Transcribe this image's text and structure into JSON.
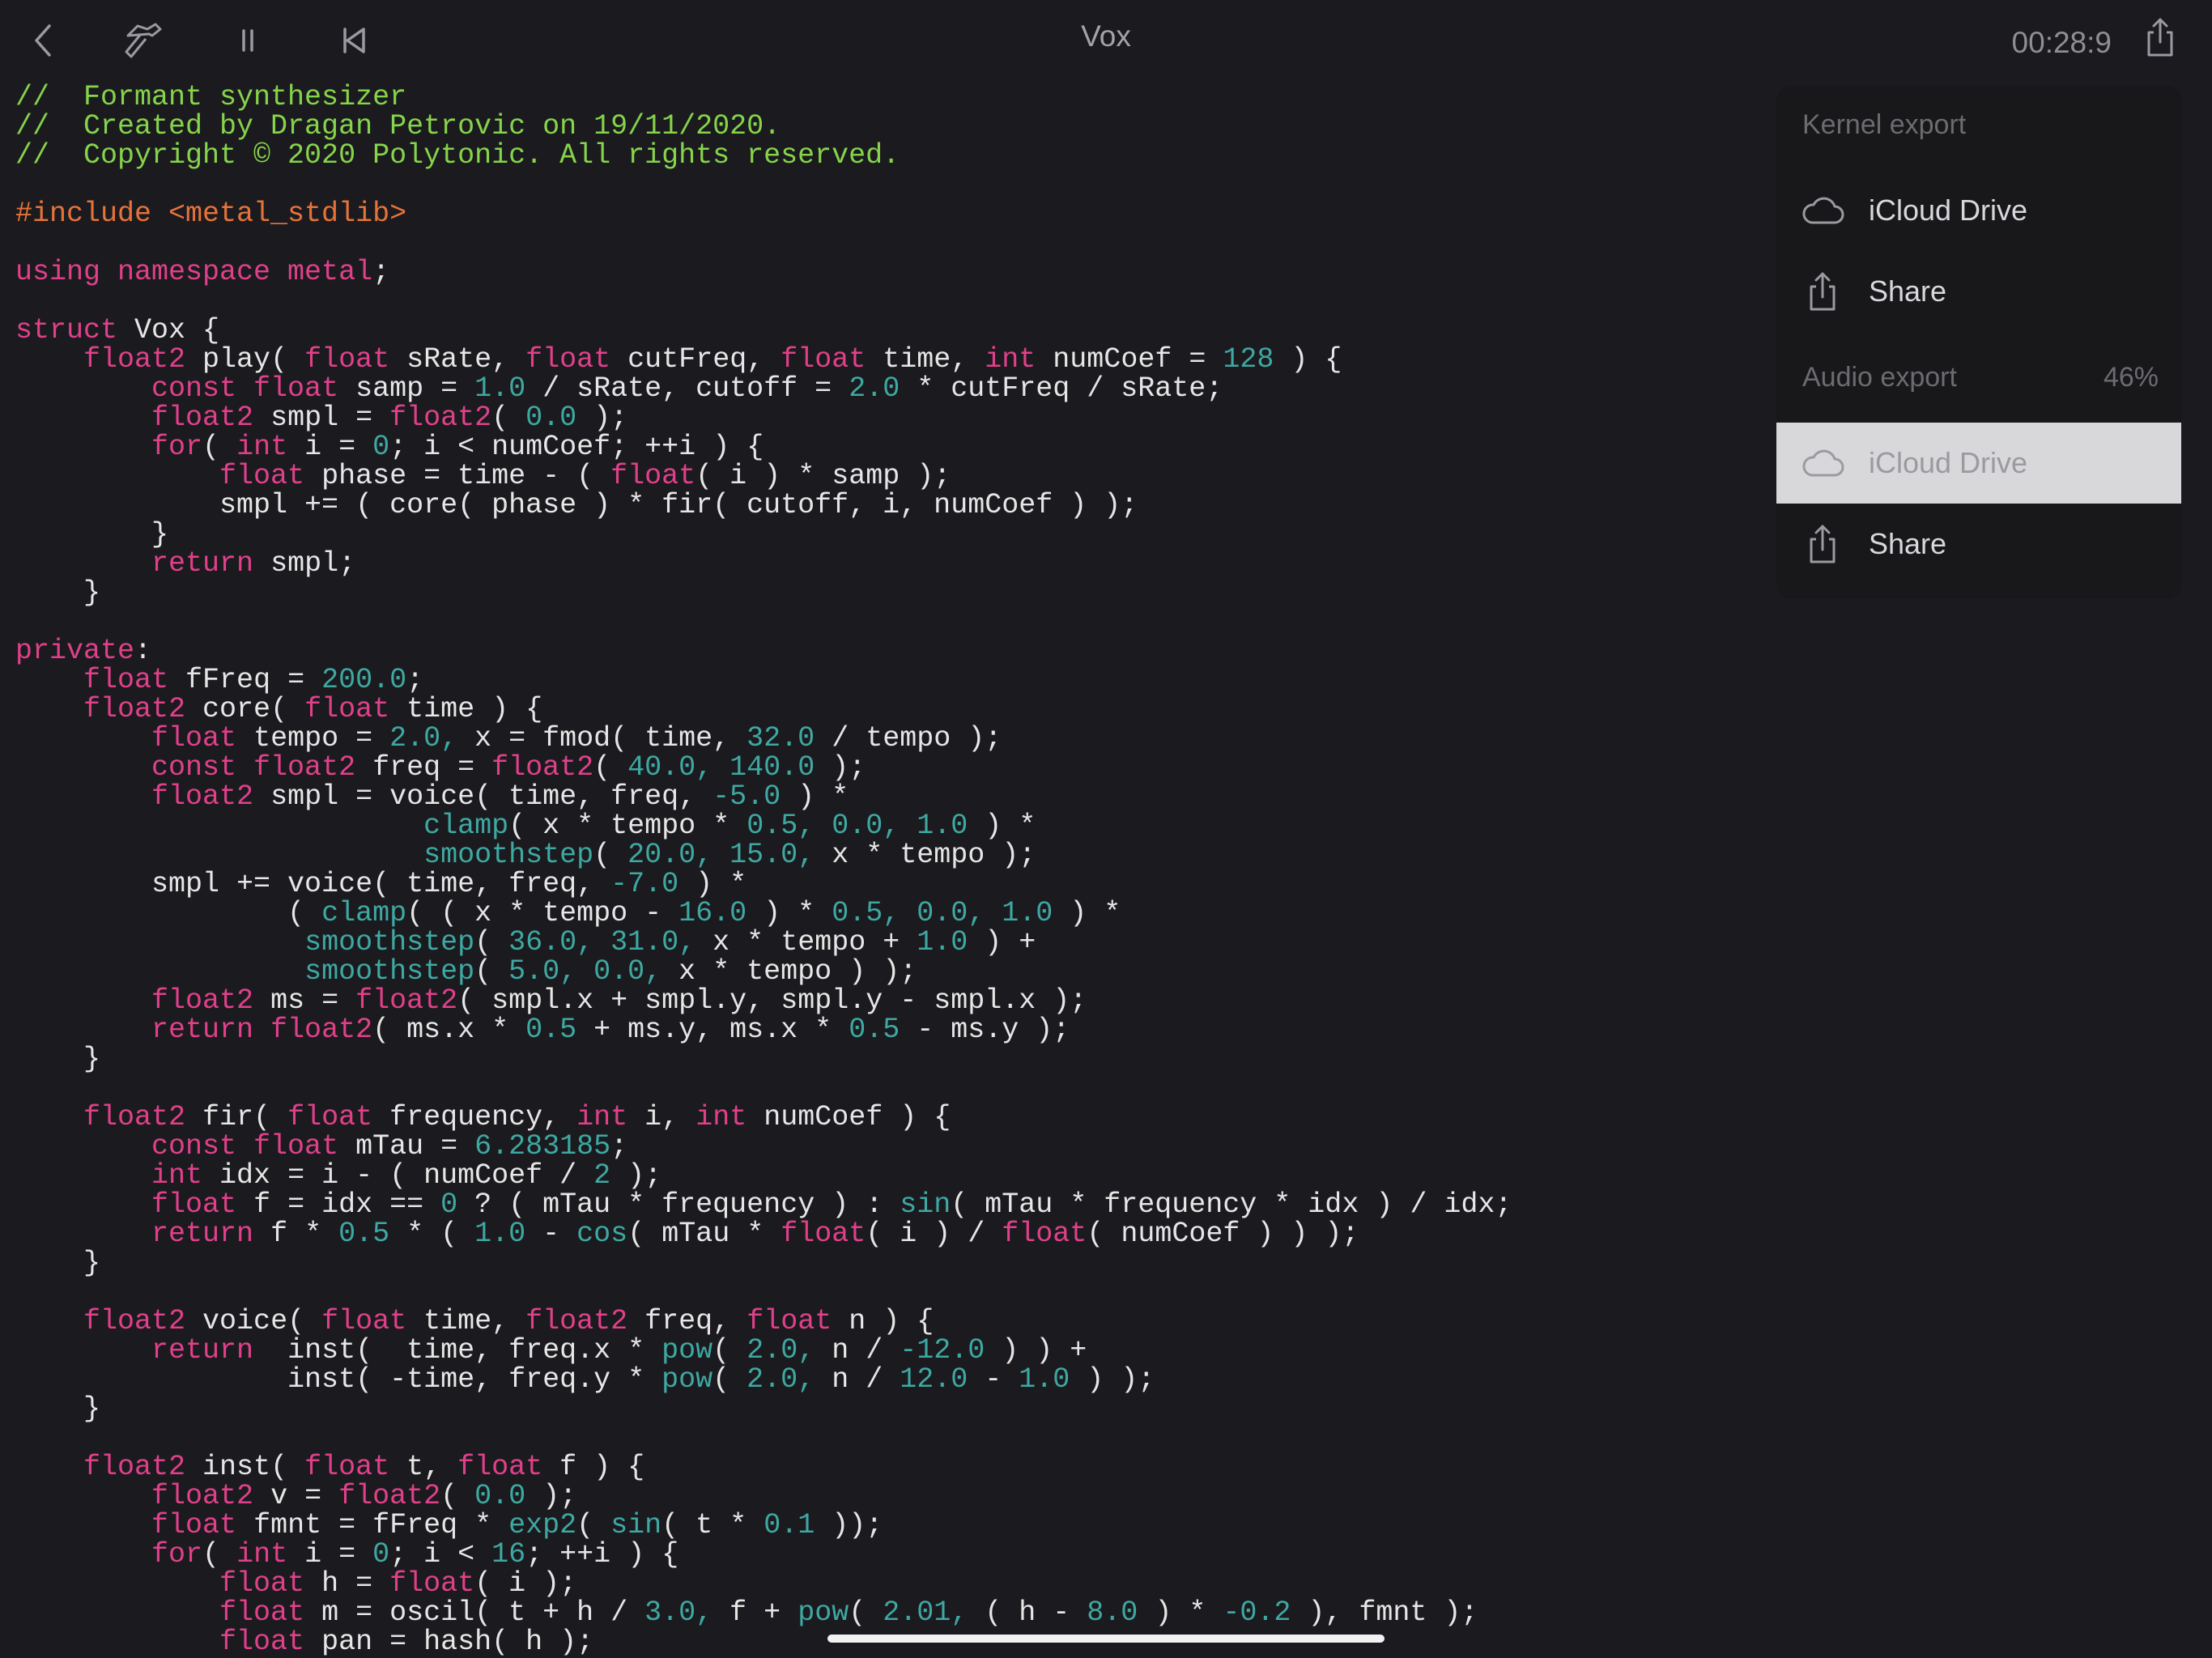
{
  "app": {
    "title": "Vox",
    "timer": "00:28:9"
  },
  "toolbar": {
    "icons": [
      "back-icon",
      "build-icon",
      "pause-icon",
      "rewind-icon",
      "share-icon"
    ]
  },
  "colors": {
    "default": "#e6e6e6",
    "comment": "#86d44a",
    "keyword": "#e0408a",
    "number": "#3ea8a2",
    "include": "#e6733a"
  },
  "code_lines": [
    [
      [
        "c",
        "//  Formant synthesizer"
      ]
    ],
    [
      [
        "c",
        "//  Created by Dragan Petrovic on 19/11/2020."
      ]
    ],
    [
      [
        "c",
        "//  Copyright © 2020 Polytonic. All rights reserved."
      ]
    ],
    [],
    [
      [
        "i",
        "#include <metal_stdlib>"
      ]
    ],
    [],
    [
      [
        "k",
        "using namespace metal"
      ],
      [
        "d",
        ";"
      ]
    ],
    [],
    [
      [
        "k",
        "struct"
      ],
      [
        "d",
        " Vox {"
      ]
    ],
    [
      [
        "d",
        "    "
      ],
      [
        "k",
        "float2"
      ],
      [
        "d",
        " play( "
      ],
      [
        "k",
        "float"
      ],
      [
        "d",
        " sRate, "
      ],
      [
        "k",
        "float"
      ],
      [
        "d",
        " cutFreq, "
      ],
      [
        "k",
        "float"
      ],
      [
        "d",
        " time, "
      ],
      [
        "k",
        "int"
      ],
      [
        "d",
        " numCoef = "
      ],
      [
        "n",
        "128"
      ],
      [
        "d",
        " ) {"
      ]
    ],
    [
      [
        "d",
        "        "
      ],
      [
        "k",
        "const float"
      ],
      [
        "d",
        " samp = "
      ],
      [
        "n",
        "1.0"
      ],
      [
        "d",
        " / sRate, cutoff = "
      ],
      [
        "n",
        "2.0"
      ],
      [
        "d",
        " * cutFreq / sRate;"
      ]
    ],
    [
      [
        "d",
        "        "
      ],
      [
        "k",
        "float2"
      ],
      [
        "d",
        " smpl = "
      ],
      [
        "k",
        "float2"
      ],
      [
        "d",
        "( "
      ],
      [
        "n",
        "0.0"
      ],
      [
        "d",
        " );"
      ]
    ],
    [
      [
        "d",
        "        "
      ],
      [
        "k",
        "for"
      ],
      [
        "d",
        "( "
      ],
      [
        "k",
        "int"
      ],
      [
        "d",
        " i = "
      ],
      [
        "n",
        "0"
      ],
      [
        "d",
        "; i < numCoef; ++i ) {"
      ]
    ],
    [
      [
        "d",
        "            "
      ],
      [
        "k",
        "float"
      ],
      [
        "d",
        " phase = time - ( "
      ],
      [
        "k",
        "float"
      ],
      [
        "d",
        "( i ) * samp );"
      ]
    ],
    [
      [
        "d",
        "            smpl += ( core( phase ) * fir( cutoff, i, numCoef ) );"
      ]
    ],
    [
      [
        "d",
        "        }"
      ]
    ],
    [
      [
        "d",
        "        "
      ],
      [
        "k",
        "return"
      ],
      [
        "d",
        " smpl;"
      ]
    ],
    [
      [
        "d",
        "    }"
      ]
    ],
    [],
    [
      [
        "k",
        "private"
      ],
      [
        "d",
        ":"
      ]
    ],
    [
      [
        "d",
        "    "
      ],
      [
        "k",
        "float"
      ],
      [
        "d",
        " fFreq = "
      ],
      [
        "n",
        "200.0"
      ],
      [
        "d",
        ";"
      ]
    ],
    [
      [
        "d",
        "    "
      ],
      [
        "k",
        "float2"
      ],
      [
        "d",
        " core( "
      ],
      [
        "k",
        "float"
      ],
      [
        "d",
        " time ) {"
      ]
    ],
    [
      [
        "d",
        "        "
      ],
      [
        "k",
        "float"
      ],
      [
        "d",
        " tempo = "
      ],
      [
        "n",
        "2.0,"
      ],
      [
        "d",
        " x = fmod( time, "
      ],
      [
        "n",
        "32.0"
      ],
      [
        "d",
        " / tempo );"
      ]
    ],
    [
      [
        "d",
        "        "
      ],
      [
        "k",
        "const float2"
      ],
      [
        "d",
        " freq = "
      ],
      [
        "k",
        "float2"
      ],
      [
        "d",
        "( "
      ],
      [
        "n",
        "40.0, 140.0"
      ],
      [
        "d",
        " );"
      ]
    ],
    [
      [
        "d",
        "        "
      ],
      [
        "k",
        "float2"
      ],
      [
        "d",
        " smpl = voice( time, freq, "
      ],
      [
        "n",
        "-5.0"
      ],
      [
        "d",
        " ) *"
      ]
    ],
    [
      [
        "d",
        "                        "
      ],
      [
        "n",
        "clamp"
      ],
      [
        "d",
        "( x * tempo * "
      ],
      [
        "n",
        "0.5, 0.0, 1.0"
      ],
      [
        "d",
        " ) *"
      ]
    ],
    [
      [
        "d",
        "                        "
      ],
      [
        "n",
        "smoothstep"
      ],
      [
        "d",
        "( "
      ],
      [
        "n",
        "20.0, 15.0,"
      ],
      [
        "d",
        " x * tempo );"
      ]
    ],
    [
      [
        "d",
        "        smpl += voice( time, freq, "
      ],
      [
        "n",
        "-7.0"
      ],
      [
        "d",
        " ) *"
      ]
    ],
    [
      [
        "d",
        "                ( "
      ],
      [
        "n",
        "clamp"
      ],
      [
        "d",
        "( ( x * tempo - "
      ],
      [
        "n",
        "16.0"
      ],
      [
        "d",
        " ) * "
      ],
      [
        "n",
        "0.5, 0.0, 1.0"
      ],
      [
        "d",
        " ) *"
      ]
    ],
    [
      [
        "d",
        "                 "
      ],
      [
        "n",
        "smoothstep"
      ],
      [
        "d",
        "( "
      ],
      [
        "n",
        "36.0, 31.0,"
      ],
      [
        "d",
        " x * tempo + "
      ],
      [
        "n",
        "1.0"
      ],
      [
        "d",
        " ) +"
      ]
    ],
    [
      [
        "d",
        "                 "
      ],
      [
        "n",
        "smoothstep"
      ],
      [
        "d",
        "( "
      ],
      [
        "n",
        "5.0, 0.0,"
      ],
      [
        "d",
        " x * tempo ) );"
      ]
    ],
    [
      [
        "d",
        "        "
      ],
      [
        "k",
        "float2"
      ],
      [
        "d",
        " ms = "
      ],
      [
        "k",
        "float2"
      ],
      [
        "d",
        "( smpl.x + smpl.y, smpl.y - smpl.x );"
      ]
    ],
    [
      [
        "d",
        "        "
      ],
      [
        "k",
        "return float2"
      ],
      [
        "d",
        "( ms.x * "
      ],
      [
        "n",
        "0.5"
      ],
      [
        "d",
        " + ms.y, ms.x * "
      ],
      [
        "n",
        "0.5"
      ],
      [
        "d",
        " - ms.y );"
      ]
    ],
    [
      [
        "d",
        "    }"
      ]
    ],
    [],
    [
      [
        "d",
        "    "
      ],
      [
        "k",
        "float2"
      ],
      [
        "d",
        " fir( "
      ],
      [
        "k",
        "float"
      ],
      [
        "d",
        " frequency, "
      ],
      [
        "k",
        "int"
      ],
      [
        "d",
        " i, "
      ],
      [
        "k",
        "int"
      ],
      [
        "d",
        " numCoef ) {"
      ]
    ],
    [
      [
        "d",
        "        "
      ],
      [
        "k",
        "const float"
      ],
      [
        "d",
        " mTau = "
      ],
      [
        "n",
        "6.283185"
      ],
      [
        "d",
        ";"
      ]
    ],
    [
      [
        "d",
        "        "
      ],
      [
        "k",
        "int"
      ],
      [
        "d",
        " idx = i - ( numCoef / "
      ],
      [
        "n",
        "2"
      ],
      [
        "d",
        " );"
      ]
    ],
    [
      [
        "d",
        "        "
      ],
      [
        "k",
        "float"
      ],
      [
        "d",
        " f = idx == "
      ],
      [
        "n",
        "0"
      ],
      [
        "d",
        " ? ( mTau * frequency ) : "
      ],
      [
        "n",
        "sin"
      ],
      [
        "d",
        "( mTau * frequency * idx ) / idx;"
      ]
    ],
    [
      [
        "d",
        "        "
      ],
      [
        "k",
        "return"
      ],
      [
        "d",
        " f * "
      ],
      [
        "n",
        "0.5"
      ],
      [
        "d",
        " * ( "
      ],
      [
        "n",
        "1.0"
      ],
      [
        "d",
        " - "
      ],
      [
        "n",
        "cos"
      ],
      [
        "d",
        "( mTau * "
      ],
      [
        "k",
        "float"
      ],
      [
        "d",
        "( i ) / "
      ],
      [
        "k",
        "float"
      ],
      [
        "d",
        "( numCoef ) ) );"
      ]
    ],
    [
      [
        "d",
        "    }"
      ]
    ],
    [],
    [
      [
        "d",
        "    "
      ],
      [
        "k",
        "float2"
      ],
      [
        "d",
        " voice( "
      ],
      [
        "k",
        "float"
      ],
      [
        "d",
        " time, "
      ],
      [
        "k",
        "float2"
      ],
      [
        "d",
        " freq, "
      ],
      [
        "k",
        "float"
      ],
      [
        "d",
        " n ) {"
      ]
    ],
    [
      [
        "d",
        "        "
      ],
      [
        "k",
        "return"
      ],
      [
        "d",
        "  inst(  time, freq.x * "
      ],
      [
        "n",
        "pow"
      ],
      [
        "d",
        "( "
      ],
      [
        "n",
        "2.0,"
      ],
      [
        "d",
        " n / "
      ],
      [
        "n",
        "-12.0"
      ],
      [
        "d",
        " ) ) +"
      ]
    ],
    [
      [
        "d",
        "                inst( -time, freq.y * "
      ],
      [
        "n",
        "pow"
      ],
      [
        "d",
        "( "
      ],
      [
        "n",
        "2.0,"
      ],
      [
        "d",
        " n / "
      ],
      [
        "n",
        "12.0"
      ],
      [
        "d",
        " - "
      ],
      [
        "n",
        "1.0"
      ],
      [
        "d",
        " ) );"
      ]
    ],
    [
      [
        "d",
        "    }"
      ]
    ],
    [],
    [
      [
        "d",
        "    "
      ],
      [
        "k",
        "float2"
      ],
      [
        "d",
        " inst( "
      ],
      [
        "k",
        "float"
      ],
      [
        "d",
        " t, "
      ],
      [
        "k",
        "float"
      ],
      [
        "d",
        " f ) {"
      ]
    ],
    [
      [
        "d",
        "        "
      ],
      [
        "k",
        "float2"
      ],
      [
        "d",
        " v = "
      ],
      [
        "k",
        "float2"
      ],
      [
        "d",
        "( "
      ],
      [
        "n",
        "0.0"
      ],
      [
        "d",
        " );"
      ]
    ],
    [
      [
        "d",
        "        "
      ],
      [
        "k",
        "float"
      ],
      [
        "d",
        " fmnt = fFreq * "
      ],
      [
        "n",
        "exp2"
      ],
      [
        "d",
        "( "
      ],
      [
        "n",
        "sin"
      ],
      [
        "d",
        "( t * "
      ],
      [
        "n",
        "0.1"
      ],
      [
        "d",
        " ));"
      ]
    ],
    [
      [
        "d",
        "        "
      ],
      [
        "k",
        "for"
      ],
      [
        "d",
        "( "
      ],
      [
        "k",
        "int"
      ],
      [
        "d",
        " i = "
      ],
      [
        "n",
        "0"
      ],
      [
        "d",
        "; i < "
      ],
      [
        "n",
        "16"
      ],
      [
        "d",
        "; ++i ) {"
      ]
    ],
    [
      [
        "d",
        "            "
      ],
      [
        "k",
        "float"
      ],
      [
        "d",
        " h = "
      ],
      [
        "k",
        "float"
      ],
      [
        "d",
        "( i );"
      ]
    ],
    [
      [
        "d",
        "            "
      ],
      [
        "k",
        "float"
      ],
      [
        "d",
        " m = oscil( t + h / "
      ],
      [
        "n",
        "3.0,"
      ],
      [
        "d",
        " f + "
      ],
      [
        "n",
        "pow"
      ],
      [
        "d",
        "( "
      ],
      [
        "n",
        "2.01,"
      ],
      [
        "d",
        " ( h - "
      ],
      [
        "n",
        "8.0"
      ],
      [
        "d",
        " ) * "
      ],
      [
        "n",
        "-0.2"
      ],
      [
        "d",
        " ), fmnt );"
      ]
    ],
    [
      [
        "d",
        "            "
      ],
      [
        "k",
        "float"
      ],
      [
        "d",
        " pan = hash( h );"
      ]
    ]
  ],
  "export_menu": {
    "kernel_header": "Kernel export",
    "kernel_items": [
      {
        "label": "iCloud Drive",
        "icon": "cloud-icon"
      },
      {
        "label": "Share",
        "icon": "share-icon"
      }
    ],
    "audio_header": "Audio export",
    "audio_progress": "46%",
    "audio_items": [
      {
        "label": "iCloud Drive",
        "icon": "cloud-icon",
        "selected": true
      },
      {
        "label": "Share",
        "icon": "share-icon"
      }
    ]
  }
}
